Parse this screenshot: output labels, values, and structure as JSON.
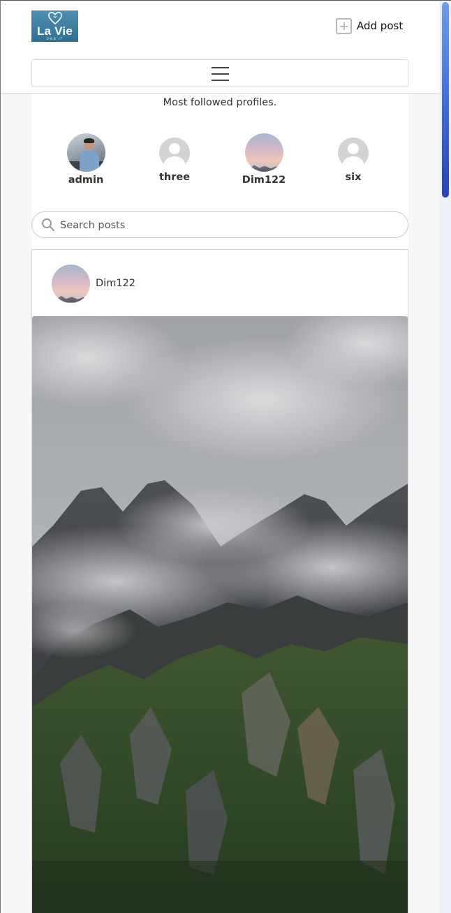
{
  "header": {
    "logo_text": "La Vie",
    "logo_subtext": "OWN IT",
    "add_post_label": "Add post"
  },
  "profiles": {
    "title": "Most followed profiles.",
    "items": [
      {
        "name": "admin",
        "avatar": "photo"
      },
      {
        "name": "three",
        "avatar": "default"
      },
      {
        "name": "Dim122",
        "avatar": "photo"
      },
      {
        "name": "six",
        "avatar": "default"
      }
    ]
  },
  "search": {
    "placeholder": "Search posts",
    "value": ""
  },
  "feed": {
    "posts": [
      {
        "author": "Dim122",
        "image": "misty-mountain-photo"
      }
    ]
  },
  "colors": {
    "logo_background": "#3a7ba0",
    "scrollbar_thumb": "#3e63cf",
    "page_background": "#f7f7f7"
  },
  "icons": {
    "add_post": "plus-square-icon",
    "menu": "hamburger-icon",
    "search": "search-icon",
    "default_avatar": "user-silhouette-icon"
  }
}
